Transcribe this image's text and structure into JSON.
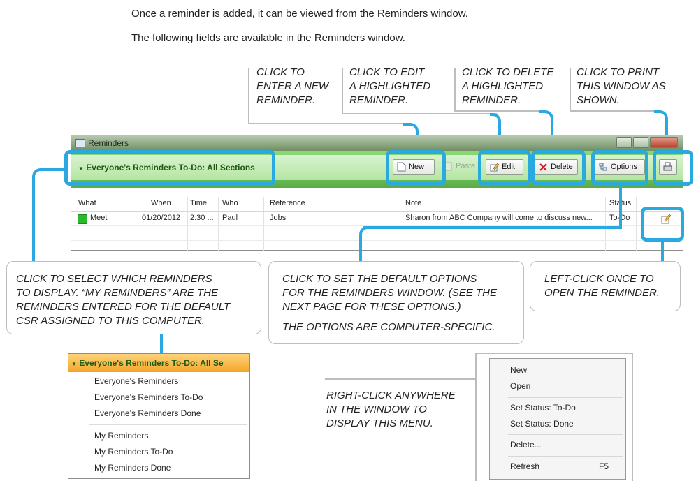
{
  "intro": {
    "line1": "Once a reminder is added, it can be viewed from the Reminders window.",
    "line2": "The following fields are available in the Reminders window."
  },
  "callouts": {
    "new": [
      "CLICK TO",
      "ENTER A NEW",
      "REMINDER."
    ],
    "edit": [
      "CLICK TO EDIT",
      "A HIGHLIGHTED",
      "REMINDER."
    ],
    "delete": [
      "CLICK TO DELETE",
      "A HIGHLIGHTED",
      "REMINDER."
    ],
    "print": [
      "CLICK TO PRINT",
      "THIS WINDOW AS",
      "SHOWN."
    ],
    "select": [
      "CLICK TO SELECT WHICH REMINDERS",
      "TO DISPLAY. “MY REMINDERS” ARE THE",
      "REMINDERS ENTERED FOR THE DEFAULT",
      "CSR ASSIGNED TO THIS COMPUTER."
    ],
    "options": [
      "CLICK TO SET THE DEFAULT OPTIONS",
      "FOR THE REMINDERS WINDOW. (SEE THE",
      "NEXT PAGE FOR THESE OPTIONS.)"
    ],
    "options_note": "THE OPTIONS ARE COMPUTER-SPECIFIC.",
    "open": [
      "LEFT-CLICK  ONCE TO",
      "OPEN THE REMINDER."
    ],
    "rightclick": [
      "RIGHT-CLICK ANYWHERE",
      "IN THE WINDOW TO",
      "DISPLAY THIS MENU."
    ]
  },
  "window": {
    "title": "Reminders",
    "section_title": "Everyone's Reminders To-Do: All Sections",
    "buttons": {
      "new": "New",
      "paste": "Paste",
      "edit": "Edit",
      "delete": "Delete",
      "options": "Options"
    },
    "columns": [
      "What",
      "When",
      "Time",
      "Who",
      "Reference",
      "Note",
      "Status"
    ],
    "rows": [
      {
        "what": "Meet",
        "when": "01/20/2012",
        "time": "2:30 ...",
        "who": "Paul",
        "reference": "Jobs",
        "note": "Sharon from ABC Company will come to discuss new...",
        "status": "To-Do"
      }
    ]
  },
  "dropdown": {
    "header": "Everyone's Reminders To-Do: All Se",
    "items": [
      "Everyone's Reminders",
      "Everyone's Reminders To-Do",
      "Everyone's Reminders Done",
      "My Reminders",
      "My Reminders To-Do",
      "My Reminders Done"
    ]
  },
  "context_menu": {
    "items": [
      "New",
      "Open",
      "Set Status: To-Do",
      "Set Status: Done",
      "Delete...",
      "Refresh"
    ],
    "shortcut_refresh": "F5"
  },
  "colors": {
    "highlight": "#29a9e0",
    "toolbar_green": "#6ec55b",
    "dropdown_orange": "#f4a52a"
  }
}
